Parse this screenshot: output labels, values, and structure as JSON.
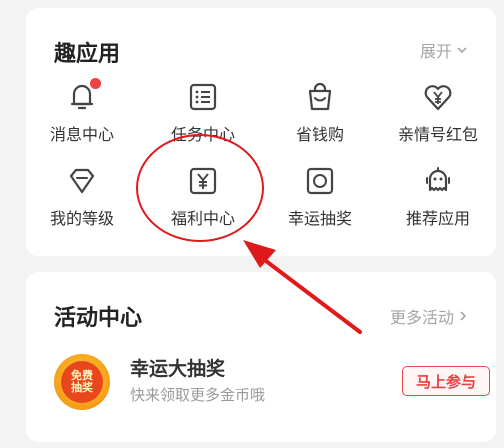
{
  "apps_section": {
    "title": "趣应用",
    "expand_label": "展开",
    "items": [
      {
        "label": "消息中心",
        "icon": "bell-icon",
        "badge": true
      },
      {
        "label": "任务中心",
        "icon": "task-list-icon"
      },
      {
        "label": "省钱购",
        "icon": "shopping-bag-icon"
      },
      {
        "label": "亲情号红包",
        "icon": "heart-yen-icon"
      },
      {
        "label": "我的等级",
        "icon": "diamond-icon"
      },
      {
        "label": "福利中心",
        "icon": "yen-box-icon"
      },
      {
        "label": "幸运抽奖",
        "icon": "lottery-icon"
      },
      {
        "label": "推荐应用",
        "icon": "robot-icon"
      }
    ]
  },
  "activity_section": {
    "title": "活动中心",
    "more_label": "更多活动",
    "promo": {
      "badge_line1": "免费",
      "badge_line2": "抽奖",
      "title": "幸运大抽奖",
      "subtitle": "快来领取更多金币哦",
      "button_label": "马上参与"
    }
  },
  "colors": {
    "background": "#f3f3f3",
    "card": "#ffffff",
    "accent_red": "#e84040",
    "annotation_red": "#e0191b",
    "icon_stroke": "#444444"
  }
}
